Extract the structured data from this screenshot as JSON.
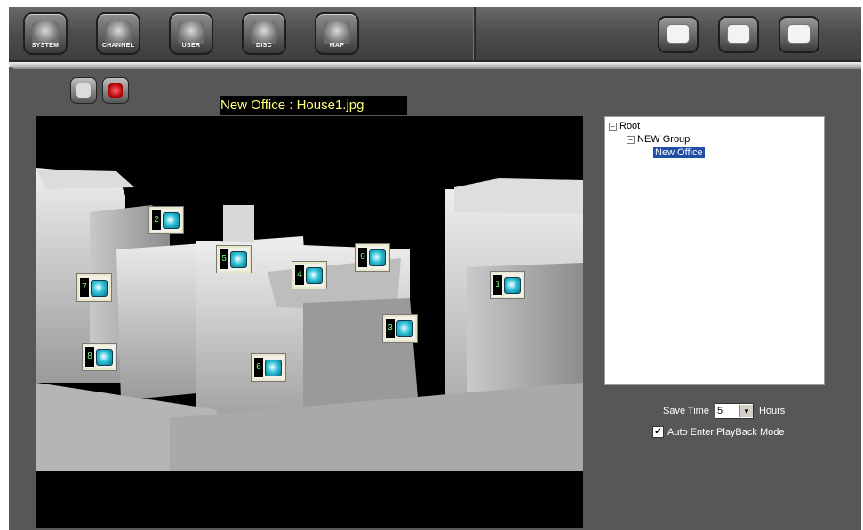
{
  "toolbar": {
    "left_buttons": [
      {
        "label": "SYSTEM",
        "icon": "system-icon"
      },
      {
        "label": "CHANNEL",
        "icon": "camera-icon"
      },
      {
        "label": "USER",
        "icon": "user-icon"
      },
      {
        "label": "DISC",
        "icon": "disc-icon"
      },
      {
        "label": "MAP",
        "icon": "map-icon"
      }
    ],
    "right_buttons": [
      {
        "icon": "keyboard-icon"
      },
      {
        "icon": "save-icon"
      },
      {
        "icon": "power-icon"
      }
    ]
  },
  "map": {
    "title": "New Office : House1.jpg",
    "sub_buttons": [
      {
        "icon": "camera-icon"
      },
      {
        "icon": "alarm-icon"
      }
    ],
    "markers": [
      {
        "num": "1"
      },
      {
        "num": "2"
      },
      {
        "num": "3"
      },
      {
        "num": "4"
      },
      {
        "num": "5"
      },
      {
        "num": "6"
      },
      {
        "num": "7"
      },
      {
        "num": "8"
      },
      {
        "num": "9"
      }
    ]
  },
  "tree": {
    "root": "Root",
    "group": "NEW Group",
    "leaf": "New Office"
  },
  "settings": {
    "save_time_label": "Save Time",
    "save_time_value": "5",
    "save_time_unit": "Hours",
    "auto_enter_label": "Auto Enter PlayBack Mode",
    "auto_enter_checked": true
  },
  "colors": {
    "background": "#575757",
    "map_title_text": "#ffff7a",
    "marker_number": "#7bff7b",
    "tree_selection": "#1f4fa6"
  }
}
